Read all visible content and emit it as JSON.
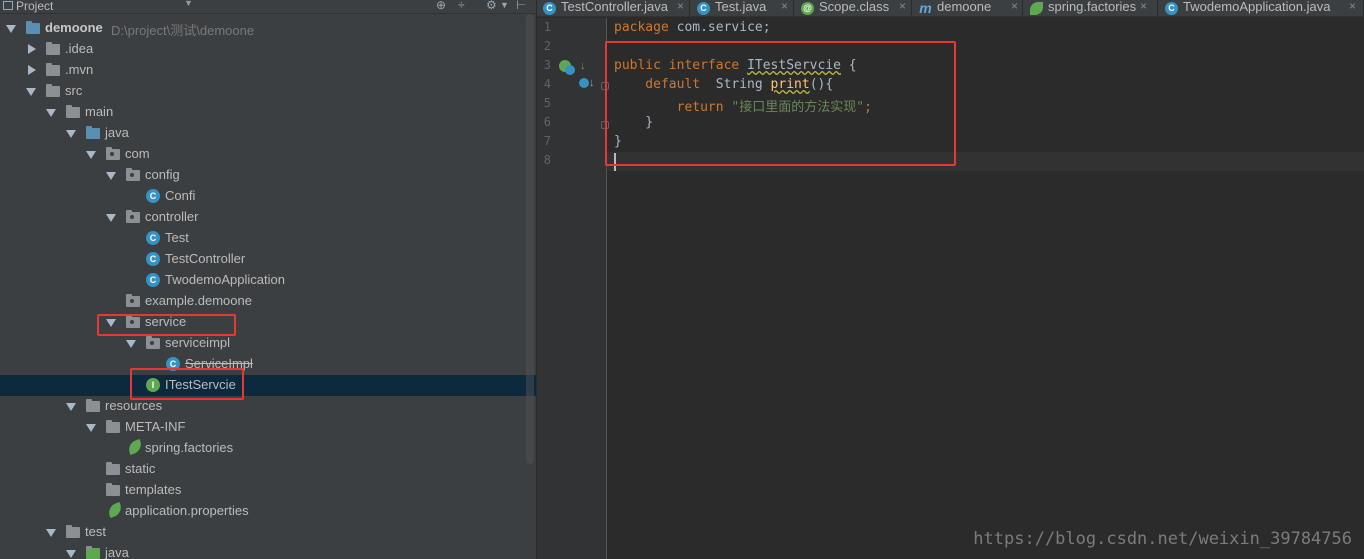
{
  "panel": {
    "title": "Project"
  },
  "tree": [
    {
      "label": "demoone",
      "path": "D:\\project\\测试\\demoone"
    },
    {
      "label": ".idea"
    },
    {
      "label": ".mvn"
    },
    {
      "label": "src"
    },
    {
      "label": "main"
    },
    {
      "label": "java"
    },
    {
      "label": "com"
    },
    {
      "label": "config"
    },
    {
      "label": "Confi"
    },
    {
      "label": "controller"
    },
    {
      "label": "Test"
    },
    {
      "label": "TestController"
    },
    {
      "label": "TwodemoApplication"
    },
    {
      "label": "example.demoone"
    },
    {
      "label": "service"
    },
    {
      "label": "serviceimpl"
    },
    {
      "label": "ServiceImpl"
    },
    {
      "label": "ITestServcie"
    },
    {
      "label": "resources"
    },
    {
      "label": "META-INF"
    },
    {
      "label": "spring.factories"
    },
    {
      "label": "static"
    },
    {
      "label": "templates"
    },
    {
      "label": "application.properties"
    },
    {
      "label": "test"
    },
    {
      "label": "java"
    }
  ],
  "tabs": [
    {
      "label": "TestController.java",
      "icon": "C"
    },
    {
      "label": "Test.java",
      "icon": "C"
    },
    {
      "label": "Scope.class",
      "icon": "@"
    },
    {
      "label": "demoone",
      "icon": "m"
    },
    {
      "label": "spring.factories",
      "icon": "leaf"
    },
    {
      "label": "TwodemoApplication.java",
      "icon": "C"
    }
  ],
  "lines": [
    "1",
    "2",
    "3",
    "4",
    "5",
    "6",
    "7",
    "8"
  ],
  "code": {
    "l1_kw": "package",
    "l1_rest": " com.service;",
    "l3_kw": "public interface ",
    "l3_name": "ITestServcie",
    "l3_rest": " {",
    "l4_kw": "    default",
    "l4_mid": "  String ",
    "l4_fn": "print",
    "l4_rest": "(){",
    "l5_kw": "        return ",
    "l5_str": "\"接口里面的方法实现\"",
    "l5_rest": ";",
    "l6": "    }",
    "l7": "}"
  },
  "watermark": "https://blog.csdn.net/weixin_39784756"
}
